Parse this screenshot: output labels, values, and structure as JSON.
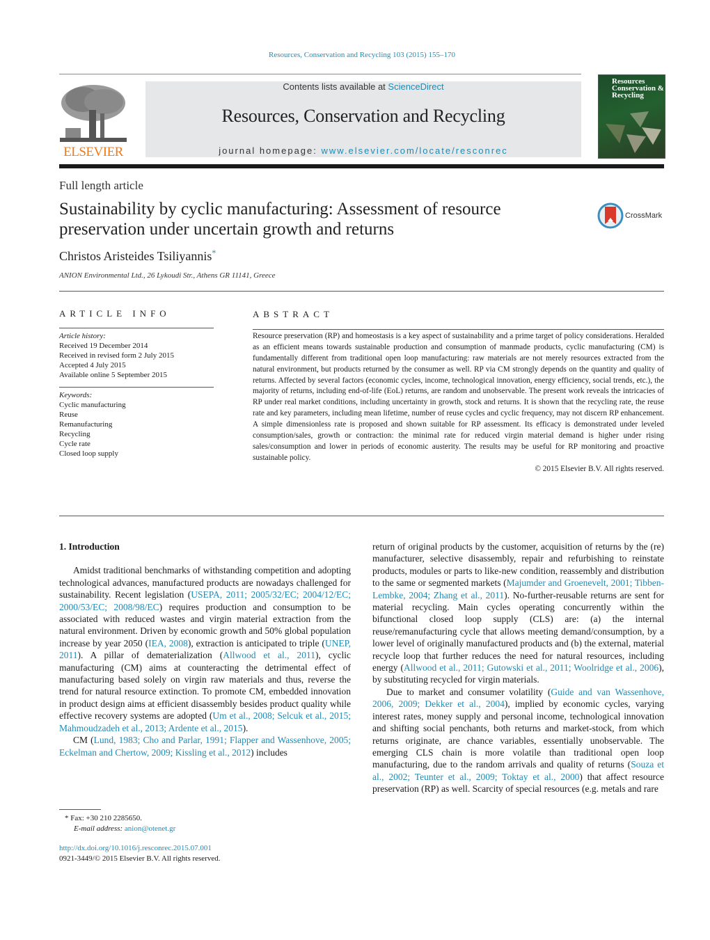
{
  "header": {
    "citation": "Resources, Conservation and Recycling 103 (2015) 155–170",
    "contents_prefix": "Contents lists available at ",
    "contents_link": "ScienceDirect",
    "journal_title": "Resources, Conservation and Recycling",
    "homepage_prefix": "journal homepage: ",
    "homepage_link": "www.elsevier.com/locate/resconrec",
    "publisher_logo": "ELSEVIER",
    "cover_title_lines": [
      "Resources",
      "Conservation &",
      "Recycling"
    ]
  },
  "colors": {
    "link": "#1f8bb5",
    "elsevier_orange": "#f07a1a",
    "header_box": "#e6e7e8"
  },
  "article": {
    "type": "Full length article",
    "title": "Sustainability by cyclic manufacturing: Assessment of resource preservation under uncertain growth and returns",
    "author": "Christos Aristeides Tsiliyannis",
    "author_mark": "*",
    "affiliation": "ANION Environmental Ltd., 26 Lykoudi Str., Athens GR 11141, Greece",
    "crossmark_label": "CrossMark"
  },
  "article_info": {
    "heading": "ARTICLE INFO",
    "history_label": "Article history:",
    "history": [
      "Received 19 December 2014",
      "Received in revised form 2 July 2015",
      "Accepted 4 July 2015",
      "Available online 5 September 2015"
    ],
    "keywords_label": "Keywords:",
    "keywords": [
      "Cyclic manufacturing",
      "Reuse",
      "Remanufacturing",
      "Recycling",
      "Cycle rate",
      "Closed loop supply"
    ]
  },
  "abstract": {
    "heading": "ABSTRACT",
    "text": "Resource preservation (RP) and homeostasis is a key aspect of sustainability and a prime target of policy considerations. Heralded as an efficient means towards sustainable production and consumption of manmade products, cyclic manufacturing (CM) is fundamentally different from traditional open loop manufacturing: raw materials are not merely resources extracted from the natural environment, but products returned by the consumer as well. RP via CM strongly depends on the quantity and quality of returns. Affected by several factors (economic cycles, income, technological innovation, energy efficiency, social trends, etc.), the majority of returns, including end-of-life (EoL) returns, are random and unobservable. The present work reveals the intricacies of RP under real market conditions, including uncertainty in growth, stock and returns. It is shown that the recycling rate, the reuse rate and key parameters, including mean lifetime, number of reuse cycles and cyclic frequency, may not discern RP enhancement. A simple dimensionless rate is proposed and shown suitable for RP assessment. Its efficacy is demonstrated under leveled consumption/sales, growth or contraction: the minimal rate for reduced virgin material demand is higher under rising sales/consumption and lower in periods of economic austerity. The results may be useful for RP monitoring and proactive sustainable policy.",
    "copyright": "© 2015 Elsevier B.V. All rights reserved."
  },
  "intro": {
    "heading": "1.  Introduction",
    "p1_a": "Amidst traditional benchmarks of withstanding competition and adopting technological advances, manufactured products are nowadays challenged for sustainability. Recent legislation (",
    "p1_ref1": "USEPA, 2011; 2005/32/EC; 2004/12/EC; 2000/53/EC; 2008/98/EC",
    "p1_b": ") requires production and consumption to be associated with reduced wastes and virgin material extraction from the natural environment. Driven by economic growth and 50% global population increase by year 2050 (",
    "p1_ref2": "IEA, 2008",
    "p1_c": "), extraction is anticipated to triple (",
    "p1_ref3": "UNEP, 2011",
    "p1_d": "). A pillar of dematerialization (",
    "p1_ref4": "Allwood et al., 2011",
    "p1_e": "), cyclic manufacturing (CM) aims at counteracting the detrimental effect of manufacturing based solely on virgin raw materials and thus, reverse the trend for natural resource extinction. To promote CM, embedded innovation in product design aims at efficient disassembly besides product quality while effective recovery systems are adopted (",
    "p1_ref5": "Um et al., 2008; Selcuk et al., 2015; Mahmoudzadeh et al., 2013; Ardente et al., 2015",
    "p1_f": ").",
    "p2_a": "CM (",
    "p2_ref1": "Lund, 1983; Cho and Parlar, 1991; Flapper and Wassenhove, 2005; Eckelman and Chertow, 2009; Kissling et al., 2012",
    "p2_b": ") includes",
    "r1_a": "return of original products by the customer, acquisition of returns by the (re) manufacturer, selective disassembly, repair and refurbishing to reinstate products, modules or parts to like-new condition, reassembly and distribution to the same or segmented markets (",
    "r1_ref1": "Majumder and Groenevelt, 2001; Tibben-Lembke, 2004; Zhang et al., 2011",
    "r1_b": "). No-further-reusable returns are sent for material recycling. Main cycles operating concurrently within the bifunctional closed loop supply (CLS) are: (a) the internal reuse/remanufacturing cycle that allows meeting demand/consumption, by a lower level of originally manufactured products and (b) the external, material recycle loop that further reduces the need for natural resources, including energy (",
    "r1_ref2": "Allwood et al., 2011; Gutowski et al., 2011; Woolridge et al., 2006",
    "r1_c": "), by substituting recycled for virgin materials.",
    "r2_a": "Due to market and consumer volatility (",
    "r2_ref1": "Guide and van Wassenhove, 2006, 2009; Dekker et al., 2004",
    "r2_b": "), implied by economic cycles, varying interest rates, money supply and personal income, technological innovation and shifting social penchants, both returns and market-stock, from which returns originate, are chance variables, essentially unobservable. The emerging CLS chain is more volatile than traditional open loop manufacturing, due to the random arrivals and quality of returns (",
    "r2_ref2": "Souza et al., 2002; Teunter et al., 2009; Toktay et al., 2000",
    "r2_c": ") that affect resource preservation (RP) as well. Scarcity of special resources (e.g. metals and rare"
  },
  "footnote": {
    "fax": "*  Fax: +30 210 2285650.",
    "email_label": "E-mail address: ",
    "email": "anion@otenet.gr",
    "doi": "http://dx.doi.org/10.1016/j.resconrec.2015.07.001",
    "issn": "0921-3449/© 2015 Elsevier B.V. All rights reserved."
  }
}
